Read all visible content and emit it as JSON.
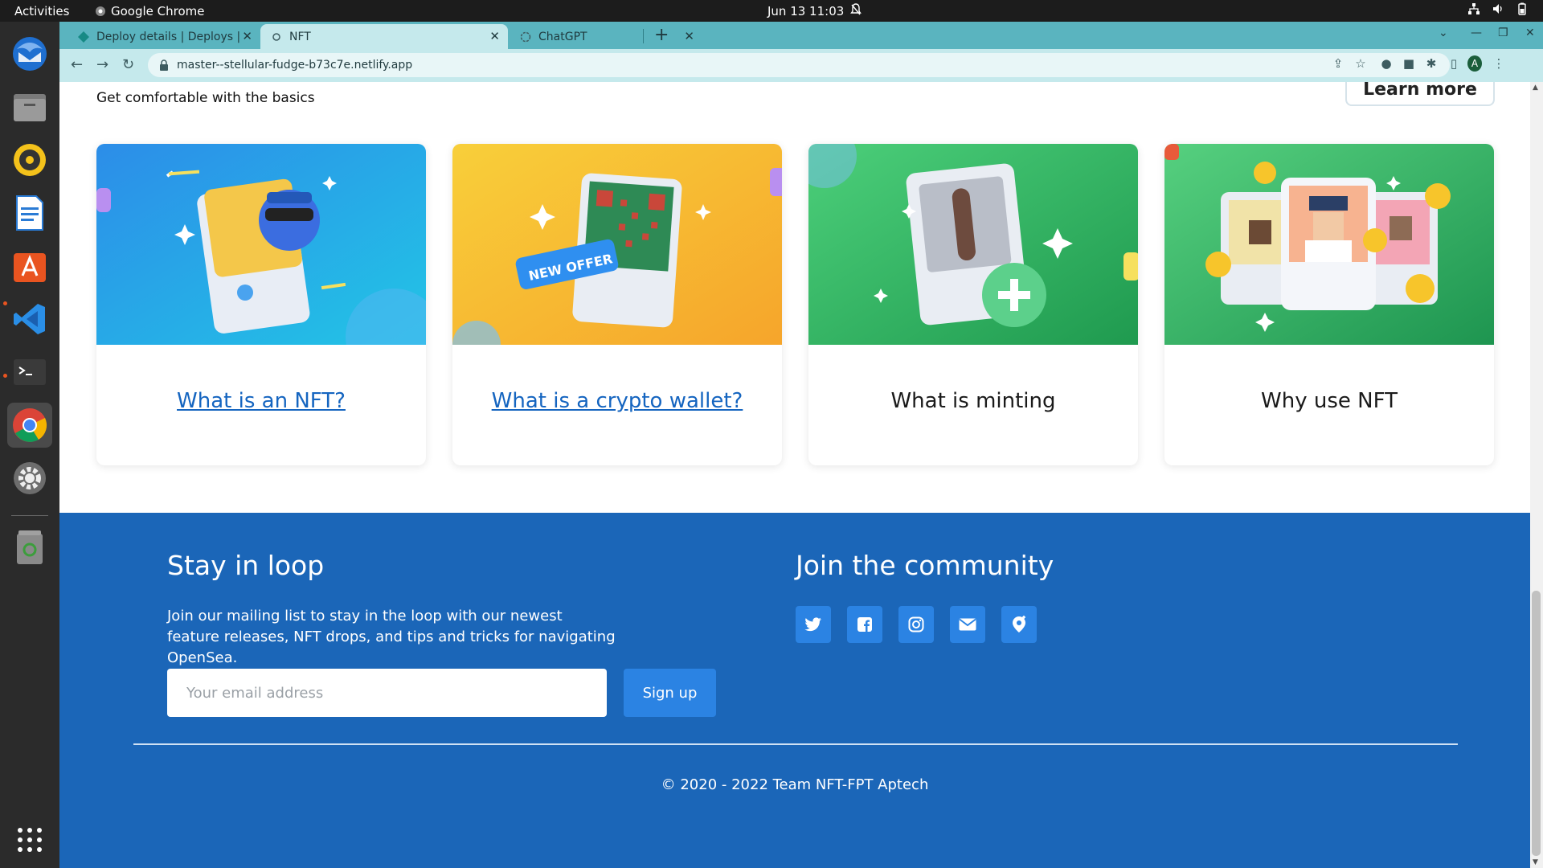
{
  "system_bar": {
    "activities": "Activities",
    "app_name": "Google Chrome",
    "clock": "Jun 13  11:03"
  },
  "browser": {
    "tabs": [
      {
        "label": "Deploy details | Deploys |",
        "icon": "netlify-icon"
      },
      {
        "label": "NFT",
        "icon": "nft-favicon-icon"
      },
      {
        "label": "ChatGPT",
        "icon": "chatgpt-icon"
      }
    ],
    "url": "master--stellular-fudge-b73c7e.netlify.app",
    "profile_initial": "A"
  },
  "basics": {
    "heading": "Get comfortable with the basics",
    "learn_more": "Learn more",
    "cards": [
      {
        "title": "What is an NFT?",
        "link": true
      },
      {
        "title": "What is a crypto wallet?",
        "link": true
      },
      {
        "title": "What is minting",
        "link": false
      },
      {
        "title": "Why use NFT",
        "link": false
      }
    ],
    "offer_badge": "NEW OFFER"
  },
  "footer": {
    "stay_title": "Stay in loop",
    "stay_desc": "Join our mailing list to stay in the loop with our newest feature releases, NFT drops, and tips and tricks for navigating OpenSea.",
    "email_placeholder": "Your email address",
    "signup": "Sign up",
    "join_title": "Join the community",
    "social": [
      "twitter-icon",
      "facebook-icon",
      "instagram-icon",
      "email-icon",
      "location-icon"
    ],
    "copyright": "© 2020 - 2022 Team NFT-FPT Aptech"
  },
  "colors": {
    "footer_bg": "#1b66b8",
    "accent_button": "#2b83e3",
    "link": "#1565c0",
    "tabstrip": "#5ab4bf"
  }
}
